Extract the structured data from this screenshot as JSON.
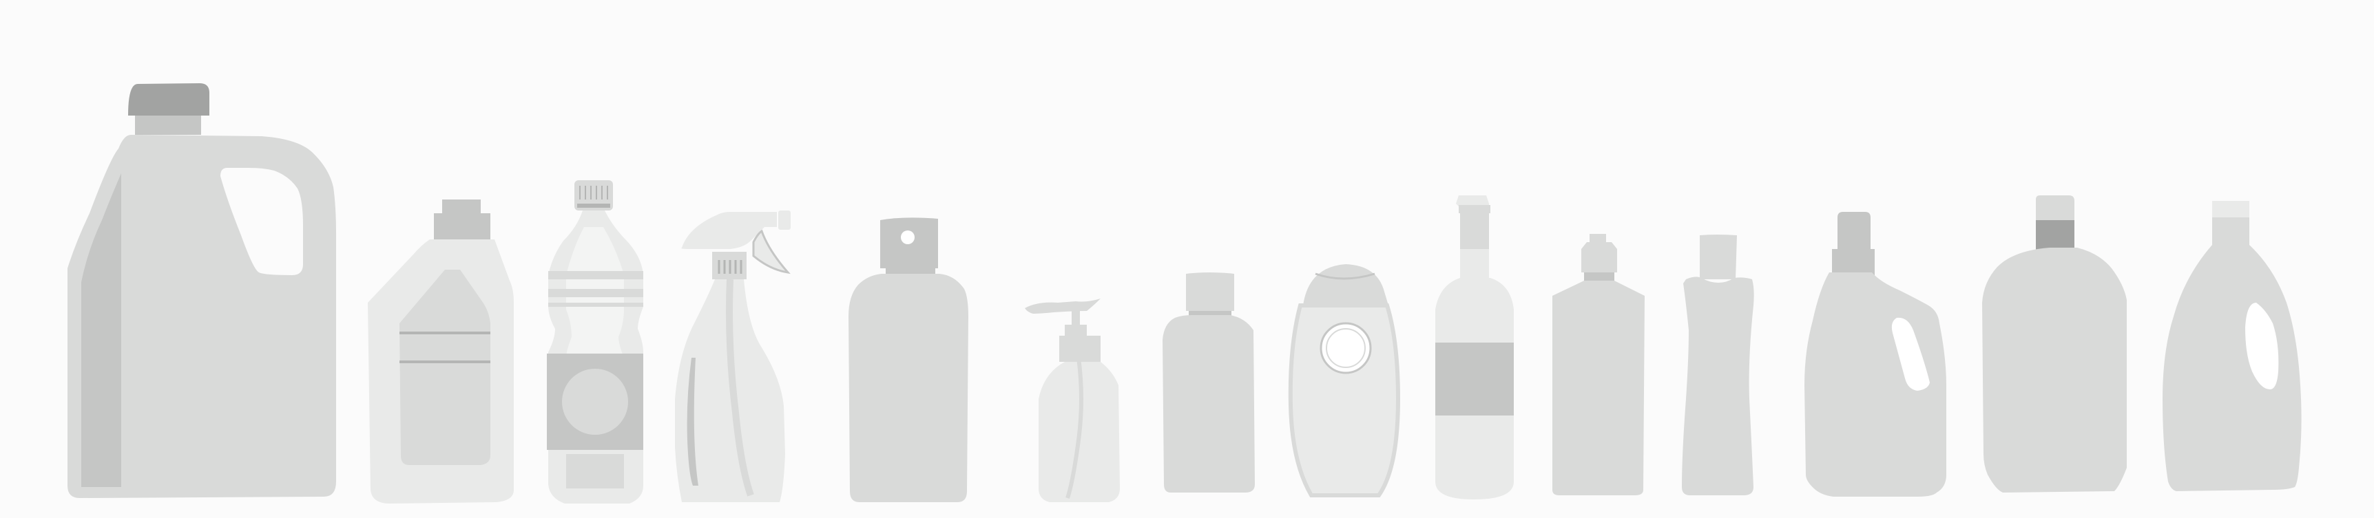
{
  "background": "#fbfbfb",
  "palette": {
    "dark": "#a2a3a2",
    "mid": "#c5c6c5",
    "light": "#d9dad9",
    "pale": "#e9eae9",
    "line": "#b4b5b4",
    "white": "#ffffff"
  },
  "bottles": [
    {
      "name": "jerrycan-jug"
    },
    {
      "name": "detergent-bottle"
    },
    {
      "name": "water-bottle"
    },
    {
      "name": "spray-bottle"
    },
    {
      "name": "flip-cap-bottle"
    },
    {
      "name": "soap-dispenser"
    },
    {
      "name": "small-square-bottle"
    },
    {
      "name": "oval-lotion-bottle"
    },
    {
      "name": "glass-vial-bottle"
    },
    {
      "name": "dropper-bottle"
    },
    {
      "name": "narrow-waist-bottle"
    },
    {
      "name": "handle-jug"
    },
    {
      "name": "wide-shoulder-bottle"
    },
    {
      "name": "round-flask-bottle"
    }
  ]
}
